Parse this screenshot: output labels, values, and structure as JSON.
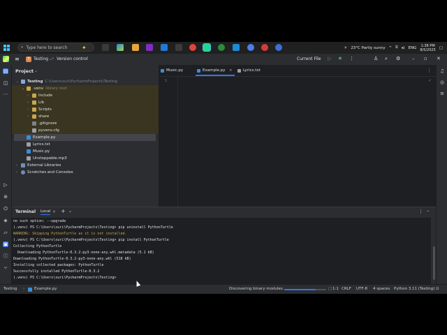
{
  "taskbar": {
    "search_placeholder": "Type here to search",
    "weather": "23°C  Partly sunny",
    "language": "ENG",
    "time": "1:38 PM",
    "date": "8/5/2025"
  },
  "titlebar": {
    "project_badge": "T",
    "project_name": "Testing",
    "version_control": "Version control",
    "run_config": "Current File"
  },
  "project_panel": {
    "title": "Project",
    "tree": [
      {
        "label": "Testing",
        "hint": "C:\\Users\\suri\\PycharmProjects\\Testing",
        "kind": "folder"
      },
      {
        "label": ".venv",
        "hint": "library root",
        "kind": "folder"
      },
      {
        "label": "Include",
        "hint": "",
        "kind": "folder"
      },
      {
        "label": "Lib",
        "hint": "",
        "kind": "folder"
      },
      {
        "label": "Scripts",
        "hint": "",
        "kind": "folder"
      },
      {
        "label": "share",
        "hint": "",
        "kind": "folder"
      },
      {
        "label": ".gitignore",
        "hint": "",
        "kind": "file"
      },
      {
        "label": "pyvenv.cfg",
        "hint": "",
        "kind": "file"
      },
      {
        "label": "Example.py",
        "hint": "",
        "kind": "python"
      },
      {
        "label": "Lyrics.txt",
        "hint": "",
        "kind": "text"
      },
      {
        "label": "Music.py",
        "hint": "",
        "kind": "python"
      },
      {
        "label": "Unstoppable.mp3",
        "hint": "",
        "kind": "audio"
      },
      {
        "label": "External Libraries",
        "hint": "",
        "kind": "lib"
      },
      {
        "label": "Scratches and Consoles",
        "hint": "",
        "kind": "scratch"
      }
    ]
  },
  "editor": {
    "tabs": [
      {
        "label": "Music.py"
      },
      {
        "label": "Example.py"
      },
      {
        "label": "Lyrics.txt"
      }
    ],
    "line_number": "1"
  },
  "terminal": {
    "title": "Terminal",
    "tab": "Local",
    "lines": [
      "no such option: --upgrade",
      "(.venv) PS C:\\Users\\suri\\PycharmProjects\\Testing> pip uninstall PythonTurtle",
      "WARNING: Skipping PythonTurtle as it is not installed.",
      "(.venv) PS C:\\Users\\suri\\PycharmProjects\\Testing> pip install PythonTurtle",
      "Collecting PythonTurtle",
      "  Downloading PythonTurtle-0.3.2-py3-none-any.whl.metadata (5.1 kB)",
      "Downloading PythonTurtle-0.3.2-py3-none-any.whl (518 kB)",
      "Installing collected packages: PythonTurtle",
      "Successfully installed PythonTurtle-0.3.2",
      "(.venv) PS C:\\Users\\suri\\PycharmProjects\\Testing>"
    ]
  },
  "statusbar": {
    "project": "Testing",
    "file": "Example.py",
    "task": "Discovering binary modules...",
    "task_progress": 0.75,
    "position": "1:1",
    "line_sep": "CRLF",
    "encoding": "UTF-8",
    "indent": "4 spaces",
    "interpreter": "Python 3.11 (Testing)"
  }
}
